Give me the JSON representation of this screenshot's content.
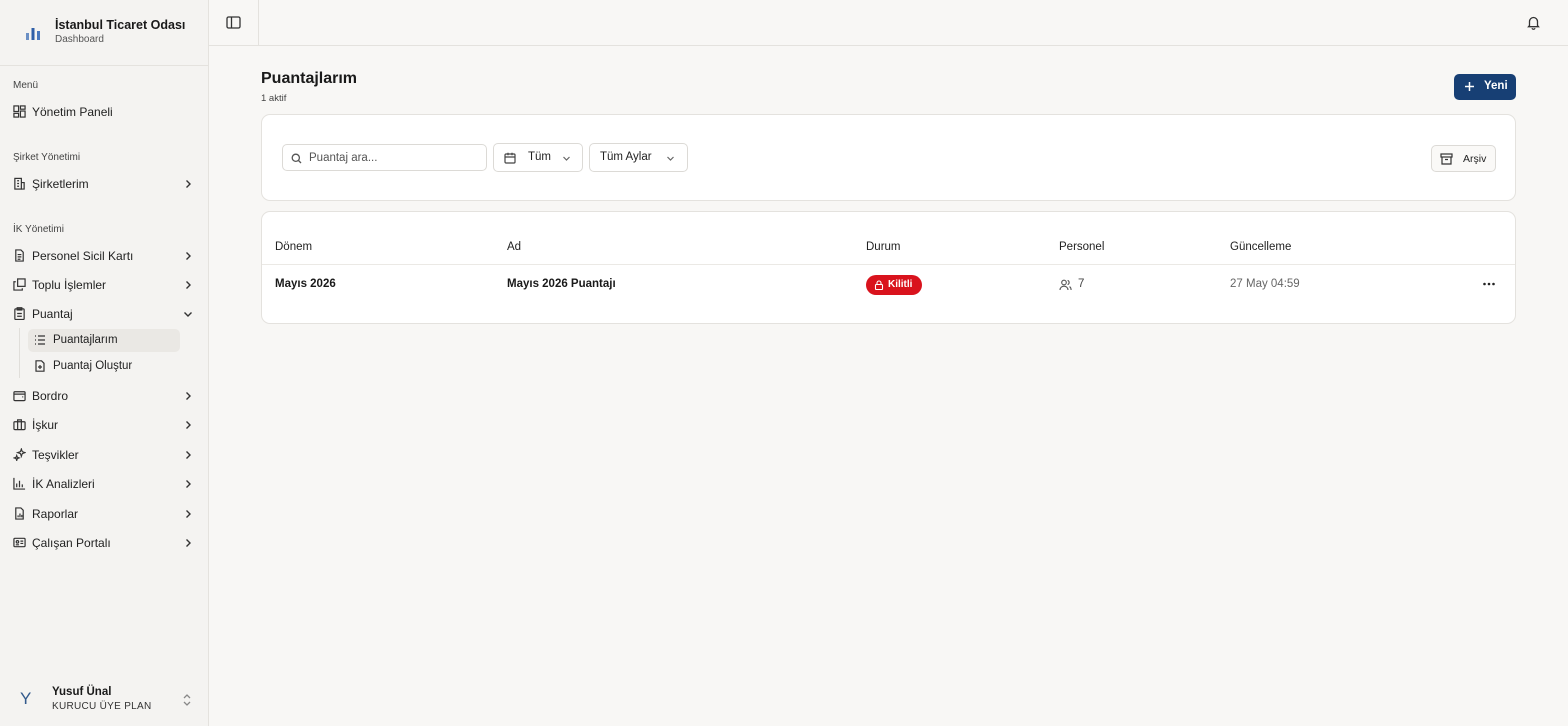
{
  "brand": {
    "title": "İstanbul Ticaret Odası",
    "subtitle": "Dashboard"
  },
  "sidebar": {
    "sections": [
      {
        "label": "Menü"
      },
      {
        "label": "Şirket Yönetimi"
      },
      {
        "label": "İK Yönetimi"
      }
    ],
    "items": [
      {
        "label": "Yönetim Paneli"
      },
      {
        "label": "Şirketlerim"
      },
      {
        "label": "Personel Sicil Kartı"
      },
      {
        "label": "Toplu İşlemler"
      },
      {
        "label": "Puantaj"
      },
      {
        "label": "Bordro"
      },
      {
        "label": "İşkur"
      },
      {
        "label": "Teşvikler"
      },
      {
        "label": "İK Analizleri"
      },
      {
        "label": "Raporlar"
      },
      {
        "label": "Çalışan Portalı"
      }
    ],
    "subitems": [
      {
        "label": "Puantajlarım",
        "active": true
      },
      {
        "label": "Puantaj Oluştur"
      }
    ]
  },
  "user": {
    "initial": "Y",
    "name": "Yusuf Ünal",
    "plan": "KURUCU ÜYE PLAN"
  },
  "page": {
    "title": "Puantajlarım",
    "subtitle": "1 aktif",
    "new_label": "Yeni"
  },
  "filters": {
    "search_placeholder": "Puantaj ara...",
    "search_value": "",
    "type_value": "Tüm",
    "month_value": "Tüm Aylar",
    "archive_label": "Arşiv"
  },
  "table": {
    "headers": [
      "Dönem",
      "Ad",
      "Durum",
      "Personel",
      "Güncelleme"
    ],
    "rows": [
      {
        "period": "Mayıs 2026",
        "name": "Mayıs 2026 Puantajı",
        "status": "Kilitli",
        "personnel": "7",
        "updated": "27 May 04:59"
      }
    ]
  },
  "colors": {
    "primary": "#173f74",
    "status_locked": "#d9131d",
    "background": "#f8f7f5"
  }
}
